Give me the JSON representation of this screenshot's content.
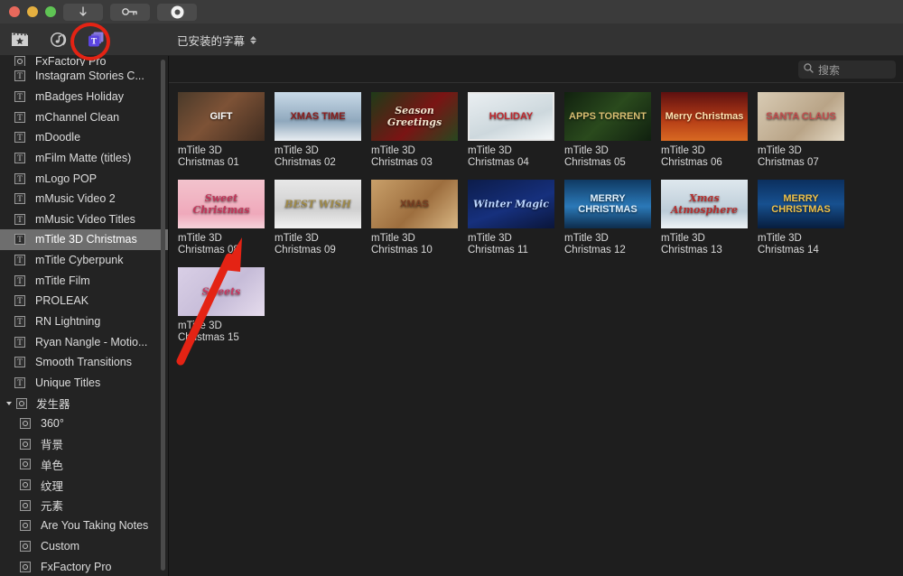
{
  "window": {
    "traffic_lights": [
      "close",
      "minimize",
      "zoom"
    ],
    "toolbar_buttons": [
      {
        "name": "download-button",
        "icon": "download-arrow-icon"
      },
      {
        "name": "key-button",
        "icon": "key-icon"
      },
      {
        "name": "record-button",
        "icon": "record-circle-icon"
      }
    ]
  },
  "toolbar": {
    "icons": [
      {
        "name": "effects-browser-icon",
        "label": "effects"
      },
      {
        "name": "audio-browser-icon",
        "label": "audio"
      },
      {
        "name": "titles-browser-icon",
        "label": "titles",
        "selected": true
      }
    ],
    "category_popup": "已安装的字幕"
  },
  "search": {
    "placeholder": "搜索",
    "value": ""
  },
  "sidebar": {
    "partial_top_item": "FxFactory Pro",
    "items": [
      {
        "label": "Instagram Stories C...",
        "icon": "title-icon",
        "type": "title"
      },
      {
        "label": "mBadges Holiday",
        "icon": "title-icon",
        "type": "title"
      },
      {
        "label": "mChannel Clean",
        "icon": "title-icon",
        "type": "title"
      },
      {
        "label": "mDoodle",
        "icon": "title-icon",
        "type": "title"
      },
      {
        "label": "mFilm Matte (titles)",
        "icon": "title-icon",
        "type": "title"
      },
      {
        "label": "mLogo POP",
        "icon": "title-icon",
        "type": "title"
      },
      {
        "label": "mMusic Video 2",
        "icon": "title-icon",
        "type": "title"
      },
      {
        "label": "mMusic Video Titles",
        "icon": "title-icon",
        "type": "title"
      },
      {
        "label": "mTitle 3D Christmas",
        "icon": "title-icon",
        "type": "title",
        "selected": true
      },
      {
        "label": "mTitle Cyberpunk",
        "icon": "title-icon",
        "type": "title"
      },
      {
        "label": "mTitle Film",
        "icon": "title-icon",
        "type": "title"
      },
      {
        "label": "PROLEAK",
        "icon": "title-icon",
        "type": "title"
      },
      {
        "label": "RN Lightning",
        "icon": "title-icon",
        "type": "title"
      },
      {
        "label": "Ryan Nangle - Motio...",
        "icon": "title-icon",
        "type": "title"
      },
      {
        "label": "Smooth Transitions",
        "icon": "title-icon",
        "type": "title"
      },
      {
        "label": "Unique Titles",
        "icon": "title-icon",
        "type": "title"
      },
      {
        "label": "发生器",
        "icon": "generator-icon",
        "type": "group",
        "expanded": true
      },
      {
        "label": "360°",
        "icon": "generator-icon",
        "type": "generator"
      },
      {
        "label": "背景",
        "icon": "generator-icon",
        "type": "generator"
      },
      {
        "label": "单色",
        "icon": "generator-icon",
        "type": "generator"
      },
      {
        "label": "纹理",
        "icon": "generator-icon",
        "type": "generator"
      },
      {
        "label": "元素",
        "icon": "generator-icon",
        "type": "generator"
      },
      {
        "label": "Are You Taking Notes",
        "icon": "generator-icon",
        "type": "generator"
      },
      {
        "label": "Custom",
        "icon": "generator-icon",
        "type": "generator"
      },
      {
        "label": "FxFactory Pro",
        "icon": "generator-icon",
        "type": "generator"
      }
    ]
  },
  "grid": {
    "items": [
      {
        "line1": "mTitle 3D",
        "line2": "Christmas 01",
        "art": "gift",
        "art_text": "GIFT"
      },
      {
        "line1": "mTitle 3D",
        "line2": "Christmas 02",
        "art": "xmastime",
        "art_text": "XMAS TIME"
      },
      {
        "line1": "mTitle 3D",
        "line2": "Christmas 03",
        "art": "seasons",
        "art_text": "Season Greetings"
      },
      {
        "line1": "mTitle 3D",
        "line2": "Christmas 04",
        "art": "holiday",
        "art_text": "HOLIDAY",
        "framed": true
      },
      {
        "line1": "mTitle 3D",
        "line2": "Christmas 05",
        "art": "apps",
        "art_text": "APPS TORRENT"
      },
      {
        "line1": "mTitle 3D",
        "line2": "Christmas 06",
        "art": "merry",
        "art_text": "Merry Christmas"
      },
      {
        "line1": "mTitle 3D",
        "line2": "Christmas 07",
        "art": "santa",
        "art_text": "SANTA CLAUS"
      },
      {
        "line1": "mTitle 3D",
        "line2": "Christmas 08",
        "art": "sweet",
        "art_text": "Sweet Christmas"
      },
      {
        "line1": "mTitle 3D",
        "line2": "Christmas 09",
        "art": "bestwish",
        "art_text": "BEST WISH"
      },
      {
        "line1": "mTitle 3D",
        "line2": "Christmas 10",
        "art": "gingerbread",
        "art_text": "XMAS"
      },
      {
        "line1": "mTitle 3D",
        "line2": "Christmas 11",
        "art": "wintermagic",
        "art_text": "Winter Magic"
      },
      {
        "line1": "mTitle 3D",
        "line2": "Christmas 12",
        "art": "snowglobe",
        "art_text": "MERRY CHRISTMAS"
      },
      {
        "line1": "mTitle 3D",
        "line2": "Christmas 13",
        "art": "atmosphere",
        "art_text": "Xmas Atmosphere"
      },
      {
        "line1": "mTitle 3D",
        "line2": "Christmas 14",
        "art": "merrywreath",
        "art_text": "MERRY CHRISTMAS"
      },
      {
        "line1": "mTitle 3D",
        "line2": "Christmas 15",
        "art": "cookies",
        "art_text": "Sweets"
      }
    ]
  },
  "annotations": {
    "highlight_color": "#e42314",
    "ring_target": "titles-browser-icon",
    "arrow_target": "sidebar-item-mtitle-3d-christmas"
  }
}
